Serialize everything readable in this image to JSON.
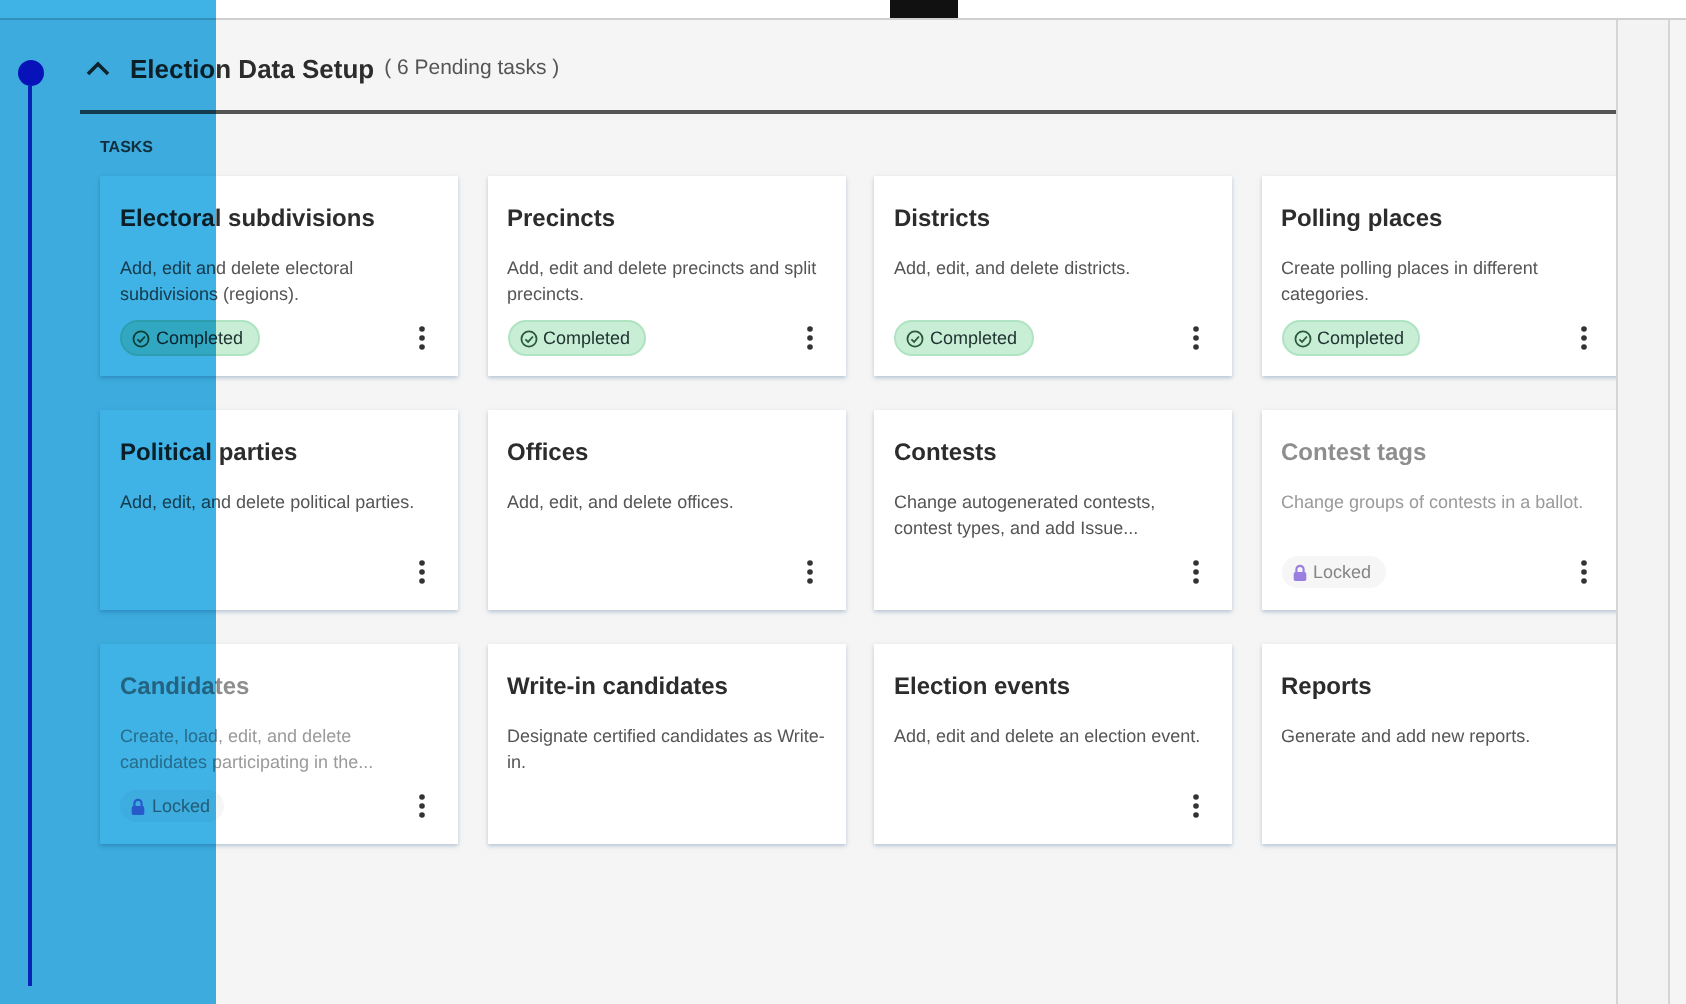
{
  "section": {
    "title": "Election Data Setup",
    "pending": "( 6 Pending tasks )",
    "expanded": true,
    "tasks_label": "TASKS"
  },
  "tasks": [
    {
      "title": "Electoral subdivisions",
      "description": "Add, edit and delete electoral subdivisions (regions).",
      "completed": true,
      "locked": false,
      "badge": "Completed",
      "menu": true
    },
    {
      "title": "Precincts",
      "description": "Add, edit and delete precincts and split precincts.",
      "completed": true,
      "locked": false,
      "badge": "Completed",
      "menu": true
    },
    {
      "title": "Districts",
      "description": "Add, edit, and delete districts.",
      "completed": true,
      "locked": false,
      "badge": "Completed",
      "menu": true
    },
    {
      "title": "Polling places",
      "description": "Create polling places in different categories.",
      "completed": true,
      "locked": false,
      "badge": "Completed",
      "menu": true
    },
    {
      "title": "Political parties",
      "description": "Add, edit, and delete political parties.",
      "completed": false,
      "locked": false,
      "menu": true
    },
    {
      "title": "Offices",
      "description": "Add, edit, and delete offices.",
      "completed": false,
      "locked": false,
      "menu": true
    },
    {
      "title": "Contests",
      "description": "Change autogenerated contests, contest types, and add Issue...",
      "completed": false,
      "locked": false,
      "menu": true
    },
    {
      "title": "Contest tags",
      "description": "Change groups of contests in a ballot.",
      "completed": false,
      "locked": true,
      "badge": "Locked",
      "menu": true
    },
    {
      "title": "Candidates",
      "description": "Create, load, edit, and delete candidates participating in the...",
      "completed": false,
      "locked": true,
      "badge": "Locked",
      "menu": true
    },
    {
      "title": "Write-in candidates",
      "description": "Designate certified candidates as Write-in.",
      "completed": false,
      "locked": false,
      "menu": false
    },
    {
      "title": "Election events",
      "description": "Add, edit and delete an election event.",
      "completed": false,
      "locked": false,
      "menu": true
    },
    {
      "title": "Reports",
      "description": "Generate and add new reports.",
      "completed": false,
      "locked": false,
      "menu": false
    }
  ]
}
